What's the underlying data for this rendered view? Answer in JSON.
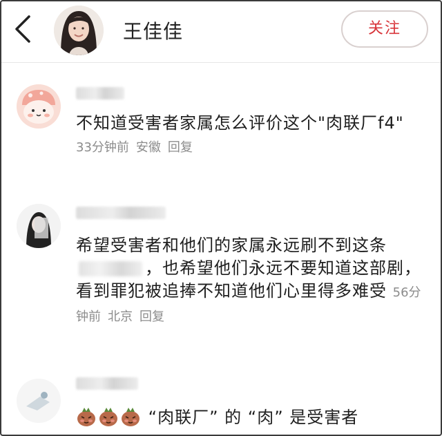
{
  "header": {
    "name": "王佳佳",
    "follow_label": "关注"
  },
  "comments": [
    {
      "text": "不知道受害者家属怎么评价这个\"肉联厂f4\"",
      "time": "33分钟前",
      "location": "安徽",
      "reply": "回复"
    },
    {
      "text_before": "希望受害者和他们的家属永远刷不到这条",
      "text_after": "，也希望他们永远不要知道这部剧，看到罪犯被追捧不知道他们心里得多难受",
      "time": "56分钟前",
      "location": "北京",
      "reply": "回复"
    },
    {
      "text": "“肉联厂” 的 “肉” 是受害者"
    }
  ],
  "icons": {
    "back": "chevron-left-icon",
    "emoji": "blushing-face-emoji"
  },
  "colors": {
    "accent": "#d8353a",
    "meta": "#8c8c8c"
  }
}
